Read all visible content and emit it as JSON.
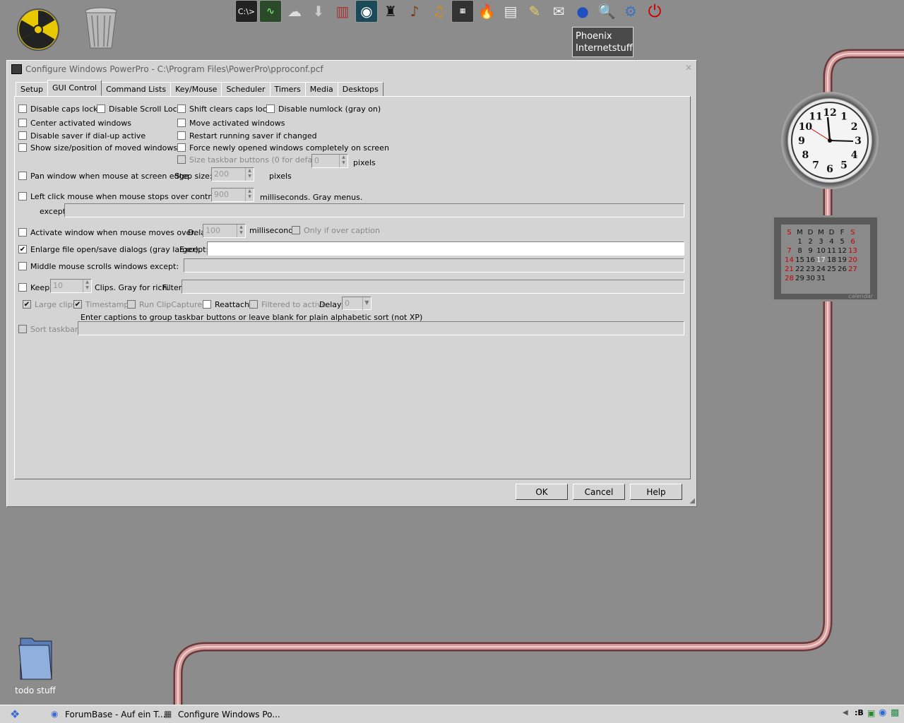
{
  "desktop": {
    "icons": [
      {
        "name": "radiation-icon",
        "label": ""
      },
      {
        "name": "recycle-bin-icon",
        "label": ""
      },
      {
        "name": "folder-icon",
        "label": "todo stuff"
      }
    ]
  },
  "launcher": {
    "items": [
      "C:\\>",
      "monitor",
      "ghost",
      "install",
      "books",
      "eye",
      "tuxedo",
      "guitar",
      "guitar2",
      "movie",
      "flame",
      "notes",
      "notepad",
      "mail",
      "globe",
      "magnifier",
      "tools",
      "power"
    ],
    "tooltip": "Phoenix\nInternetstuff"
  },
  "window": {
    "title": "Configure Windows PowerPro - C:\\Program Files\\PowerPro\\pproconf.pcf",
    "tabs": [
      "Setup",
      "GUI Control",
      "Command Lists",
      "Key/Mouse",
      "Scheduler",
      "Timers",
      "Media",
      "Desktops"
    ],
    "active_tab": "GUI Control",
    "options": {
      "disable_caps_lock": "Disable caps lock",
      "disable_scroll_lock": "Disable Scroll Lock",
      "shift_clears_caps": "Shift clears caps lock",
      "disable_numlock": "Disable numlock (gray on)",
      "center_activated": "Center activated windows",
      "move_activated": "Move activated windows",
      "disable_saver": "Disable saver if dial-up active",
      "restart_saver": "Restart running saver if changed",
      "show_size": "Show size/position of moved windows",
      "force_new": "Force newly opened windows completely on screen",
      "size_taskbar": "Size taskbar buttons (0 for default)",
      "size_taskbar_value": "0",
      "pixels1": "pixels",
      "pan_window": "Pan window when mouse at screen edge.",
      "step_size": "Step size:",
      "step_value": "200",
      "pixels2": "pixels",
      "left_click": "Left click mouse when mouse stops over control for",
      "left_click_value": "900",
      "ms_gray_menus": "milliseconds.  Gray menus.",
      "except": "except",
      "activate_window": "Activate window when mouse moves over.",
      "delay": "Delay:",
      "delay_value": "100",
      "milliseconds": "milliseconds",
      "only_caption": "Only if over caption",
      "enlarge_file": "Enlarge file open/save dialogs (gray larger).",
      "except2": "Except:",
      "middle_mouse": "Middle mouse scrolls windows except:",
      "keep": "Keep",
      "keep_value": "10",
      "clips": "Clips.  Gray for rich.",
      "filter": "Filter:",
      "large_clips": "Large clips",
      "timestamp": "Timestamp",
      "run_clipcaptured": "Run ClipCaptured",
      "reattach": "Reattach",
      "filtered_active": "Filtered to active",
      "delay2": "Delay:",
      "delay2_value": "0",
      "captions_note": "Enter captions to group taskbar buttons or leave blank for plain alphabetic sort (not XP)",
      "sort_taskbar": "Sort taskbar"
    },
    "buttons": {
      "ok": "OK",
      "cancel": "Cancel",
      "help": "Help"
    }
  },
  "calendar": {
    "headers": [
      "S",
      "M",
      "D",
      "M",
      "D",
      "F",
      "S"
    ],
    "days": [
      "",
      "1",
      "2",
      "3",
      "4",
      "5",
      "6",
      "7",
      "8",
      "9",
      "10",
      "11",
      "12",
      "13",
      "14",
      "15",
      "16",
      "17",
      "18",
      "19",
      "20",
      "21",
      "22",
      "23",
      "24",
      "25",
      "26",
      "27",
      "28",
      "29",
      "30",
      "31",
      "",
      "",
      ""
    ],
    "footer": "calendar"
  },
  "clock": {
    "numerals": [
      "12",
      "1",
      "2",
      "3",
      "4",
      "5",
      "6",
      "7",
      "8",
      "9",
      "10",
      "11"
    ]
  },
  "taskbar": {
    "items": [
      "ForumBase - Auf ein T...",
      "Configure Windows Po..."
    ],
    "tray": ":B"
  },
  "colors": {
    "pipe": "#c98a8a",
    "weekend": "#cc0000"
  }
}
